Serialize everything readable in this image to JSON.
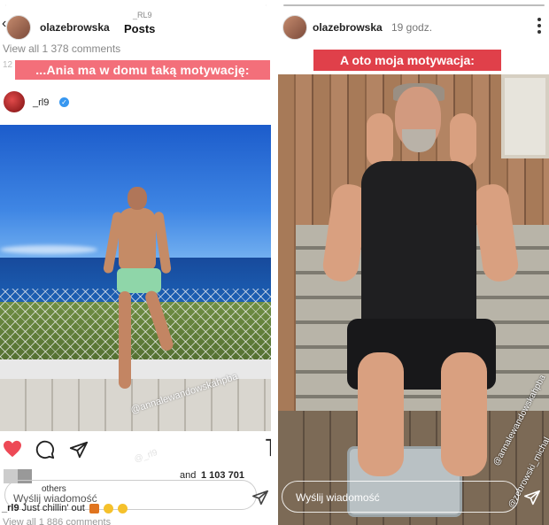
{
  "left": {
    "username": "olazebrowska",
    "header_title": "Posts",
    "header_subtitle": "_RL9",
    "view_all_top": "View all 1 378 comments",
    "date": "12 Jul",
    "story_caption": "...Ania ma w domu taką motywację:",
    "post_author": "_rl9",
    "mentions": [
      "@annalewandowskahpba",
      "@_rl9"
    ],
    "likes_and": "and",
    "likes_count": "1 103 701",
    "others": "others",
    "reply_placeholder": "Wyślij wiadomość",
    "caption_user": "_rl9",
    "caption_text": "Just chillin' out",
    "view_all_bottom": "View all 1 886 comments",
    "progress": 1.0
  },
  "right": {
    "username": "olazebrowska",
    "time": "19 godz.",
    "story_caption": "A oto moja motywacja:",
    "mentions": [
      "@annalewandowskahpba",
      "@zebrowski_michal"
    ],
    "reply_placeholder": "Wyślij wiadomość",
    "progress": 1.0
  },
  "colors": {
    "left_caption_bg": "#f36f7a",
    "right_caption_bg": "#e0404a",
    "heart": "#ed4956",
    "verified": "#3797f0"
  },
  "icons": [
    "back-chevron-icon",
    "close-icon",
    "verified-icon",
    "heart-icon",
    "comment-icon",
    "share-icon",
    "save-icon",
    "send-icon",
    "more-dots-icon"
  ]
}
